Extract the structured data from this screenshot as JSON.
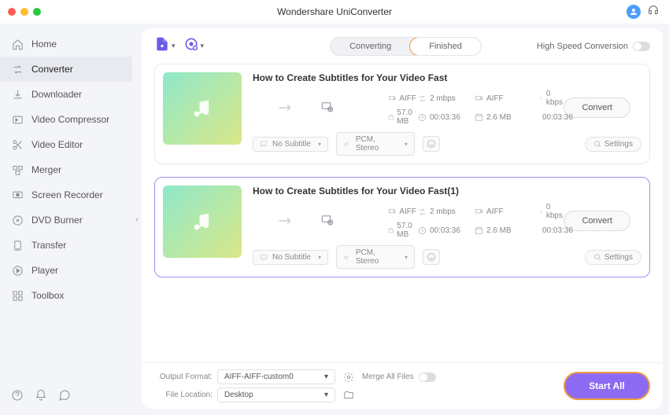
{
  "app_title": "Wondershare UniConverter",
  "sidebar": {
    "items": [
      {
        "label": "Home",
        "icon": "home-icon"
      },
      {
        "label": "Converter",
        "icon": "converter-icon"
      },
      {
        "label": "Downloader",
        "icon": "download-icon"
      },
      {
        "label": "Video Compressor",
        "icon": "compress-icon"
      },
      {
        "label": "Video Editor",
        "icon": "scissors-icon"
      },
      {
        "label": "Merger",
        "icon": "merge-icon"
      },
      {
        "label": "Screen Recorder",
        "icon": "record-icon"
      },
      {
        "label": "DVD Burner",
        "icon": "disc-icon"
      },
      {
        "label": "Transfer",
        "icon": "transfer-icon"
      },
      {
        "label": "Player",
        "icon": "play-icon"
      },
      {
        "label": "Toolbox",
        "icon": "grid-icon"
      }
    ]
  },
  "tabs": {
    "converting": "Converting",
    "finished": "Finished"
  },
  "high_speed_label": "High Speed Conversion",
  "items": [
    {
      "title": "How to Create Subtitles for Your Video Fast",
      "src": {
        "fmt": "AIFF",
        "bitrate": "2 mbps",
        "size": "57.0 MB",
        "dur": "00:03:36"
      },
      "dst": {
        "fmt": "AIFF",
        "bitrate": "0 kbps",
        "size": "2.6 MB",
        "dur": "00:03:36"
      },
      "subtitle": "No Subtitle",
      "audio": "PCM, Stereo",
      "settings": "Settings",
      "convert": "Convert"
    },
    {
      "title": "How to Create Subtitles for Your Video Fast(1)",
      "src": {
        "fmt": "AIFF",
        "bitrate": "2 mbps",
        "size": "57.0 MB",
        "dur": "00:03:36"
      },
      "dst": {
        "fmt": "AIFF",
        "bitrate": "0 kbps",
        "size": "2.6 MB",
        "dur": "00:03:36"
      },
      "subtitle": "No Subtitle",
      "audio": "PCM, Stereo",
      "settings": "Settings",
      "convert": "Convert"
    }
  ],
  "footer": {
    "output_label": "Output Format:",
    "output_value": "AIFF-AIFF-custom0",
    "location_label": "File Location:",
    "location_value": "Desktop",
    "merge_label": "Merge All Files",
    "start": "Start All"
  }
}
